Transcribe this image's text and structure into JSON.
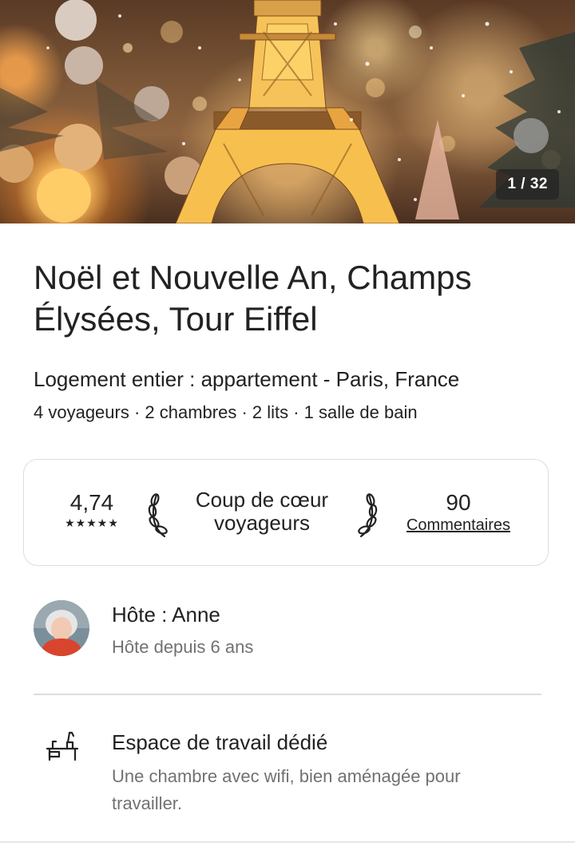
{
  "hero": {
    "photo_counter": "1 / 32"
  },
  "listing": {
    "title": "Noël et Nouvelle An, Champs Élysées, Tour Eiffel",
    "subtitle": "Logement entier : appartement - Paris, France",
    "details": "4 voyageurs · 2 chambres · 2 lits · 1 salle de bain"
  },
  "rating_card": {
    "rating": "4,74",
    "stars": "★★★★★",
    "badge_line1": "Coup de cœur",
    "badge_line2": "voyageurs",
    "reviews_count": "90",
    "reviews_label": "Commentaires"
  },
  "host": {
    "name": "Hôte : Anne",
    "since": "Hôte depuis 6 ans"
  },
  "amenity": {
    "icon": "desk-icon",
    "title": "Espace de travail dédié",
    "description": "Une chambre avec wifi, bien aménagée pour travailler."
  },
  "colors": {
    "text_primary": "#222222",
    "text_secondary": "#717171",
    "border": "#dddddd"
  }
}
